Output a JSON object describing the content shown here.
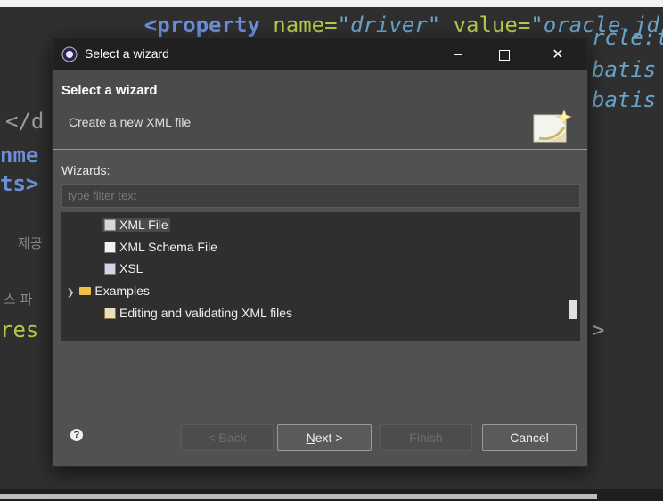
{
  "dialog": {
    "title": "Select a wizard",
    "header_title": "Select a wizard",
    "header_desc": "Create a new XML file",
    "wizards_label": "Wizards:",
    "filter_placeholder": "type filter text"
  },
  "tree": {
    "items": [
      {
        "label": "XML File",
        "icon": "xml-file-icon",
        "selected": true
      },
      {
        "label": "XML Schema File",
        "icon": "xml-schema-icon"
      },
      {
        "label": "XSL",
        "icon": "xsl-icon"
      },
      {
        "label": "Examples",
        "icon": "folder-icon",
        "expanded": true
      },
      {
        "label": "Editing and validating XML files",
        "icon": "example-icon"
      }
    ]
  },
  "buttons": {
    "help": "?",
    "back": "< Back",
    "next_mnemonic": "N",
    "next_rest": "ext >",
    "finish": "Finish",
    "cancel": "Cancel"
  },
  "background": {
    "line1_kw": "<property",
    "line1_attr1": " name=",
    "line1_val1": "\"driver\"",
    "line1_attr2": " value=",
    "line1_val2": "\"oracle.jd",
    "line2_tail": "rcle:t",
    "line3_tail": "batis",
    "line4_tail": "batis",
    "left1": "</d",
    "left2": "nme",
    "left3": "ts>",
    "left4": "res",
    "kor1": "제공",
    "kor2": "스 파",
    "right_tag": ">"
  },
  "colors": {
    "dialog_bg": "#515151",
    "titlebar_bg": "#202020",
    "tree_bg": "#2f2f2f"
  }
}
